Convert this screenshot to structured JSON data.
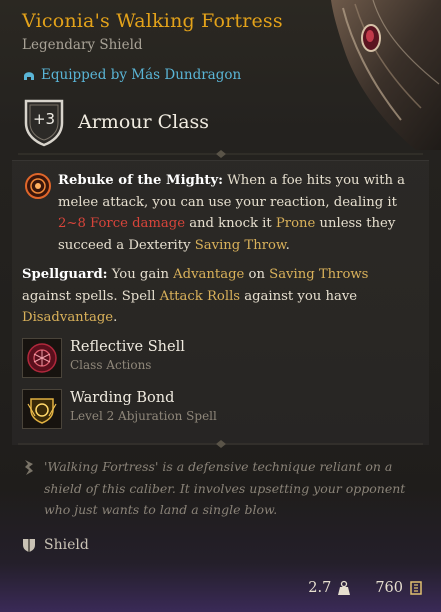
{
  "item": {
    "name": "Viconia's Walking Fortress",
    "rarity": "Legendary Shield",
    "equipped_by": "Equipped by Más Dundragon"
  },
  "armour": {
    "value": "+3",
    "label": "Armour Class"
  },
  "rebuke": {
    "name": "Rebuke of the Mighty:",
    "t1": " When a foe hits you with a melee attack, you can use your reaction, dealing it ",
    "damage": "2~8 Force damage",
    "t2": " and knock it ",
    "prone": "Prone",
    "t3": " unless they succeed a Dexterity ",
    "saving_throw": "Saving Throw",
    "t4": "."
  },
  "spellguard": {
    "name": "Spellguard:",
    "t1": " You gain ",
    "advantage": "Advantage",
    "t2": " on ",
    "saving_throws": "Saving Throws",
    "t3": " against spells. Spell ",
    "attack_rolls": "Attack Rolls",
    "t4": " against you have ",
    "disadvantage": "Disadvantage",
    "t5": "."
  },
  "actions": [
    {
      "name": "Reflective Shell",
      "sub": "Class Actions",
      "icon": "reflective-shell-icon"
    },
    {
      "name": "Warding Bond",
      "sub": "Level 2 Abjuration Spell",
      "icon": "warding-bond-icon"
    }
  ],
  "flavor": "'Walking Fortress' is a defensive technique reliant on a shield of this caliber. It involves upsetting your opponent who just wants to land a single blow.",
  "category": "Shield",
  "footer": {
    "weight": "2.7",
    "value": "760"
  },
  "colors": {
    "title": "#e3a21a",
    "equipped": "#5ab5d6",
    "keyword": "#d9b15a",
    "damage": "#d7443a"
  }
}
